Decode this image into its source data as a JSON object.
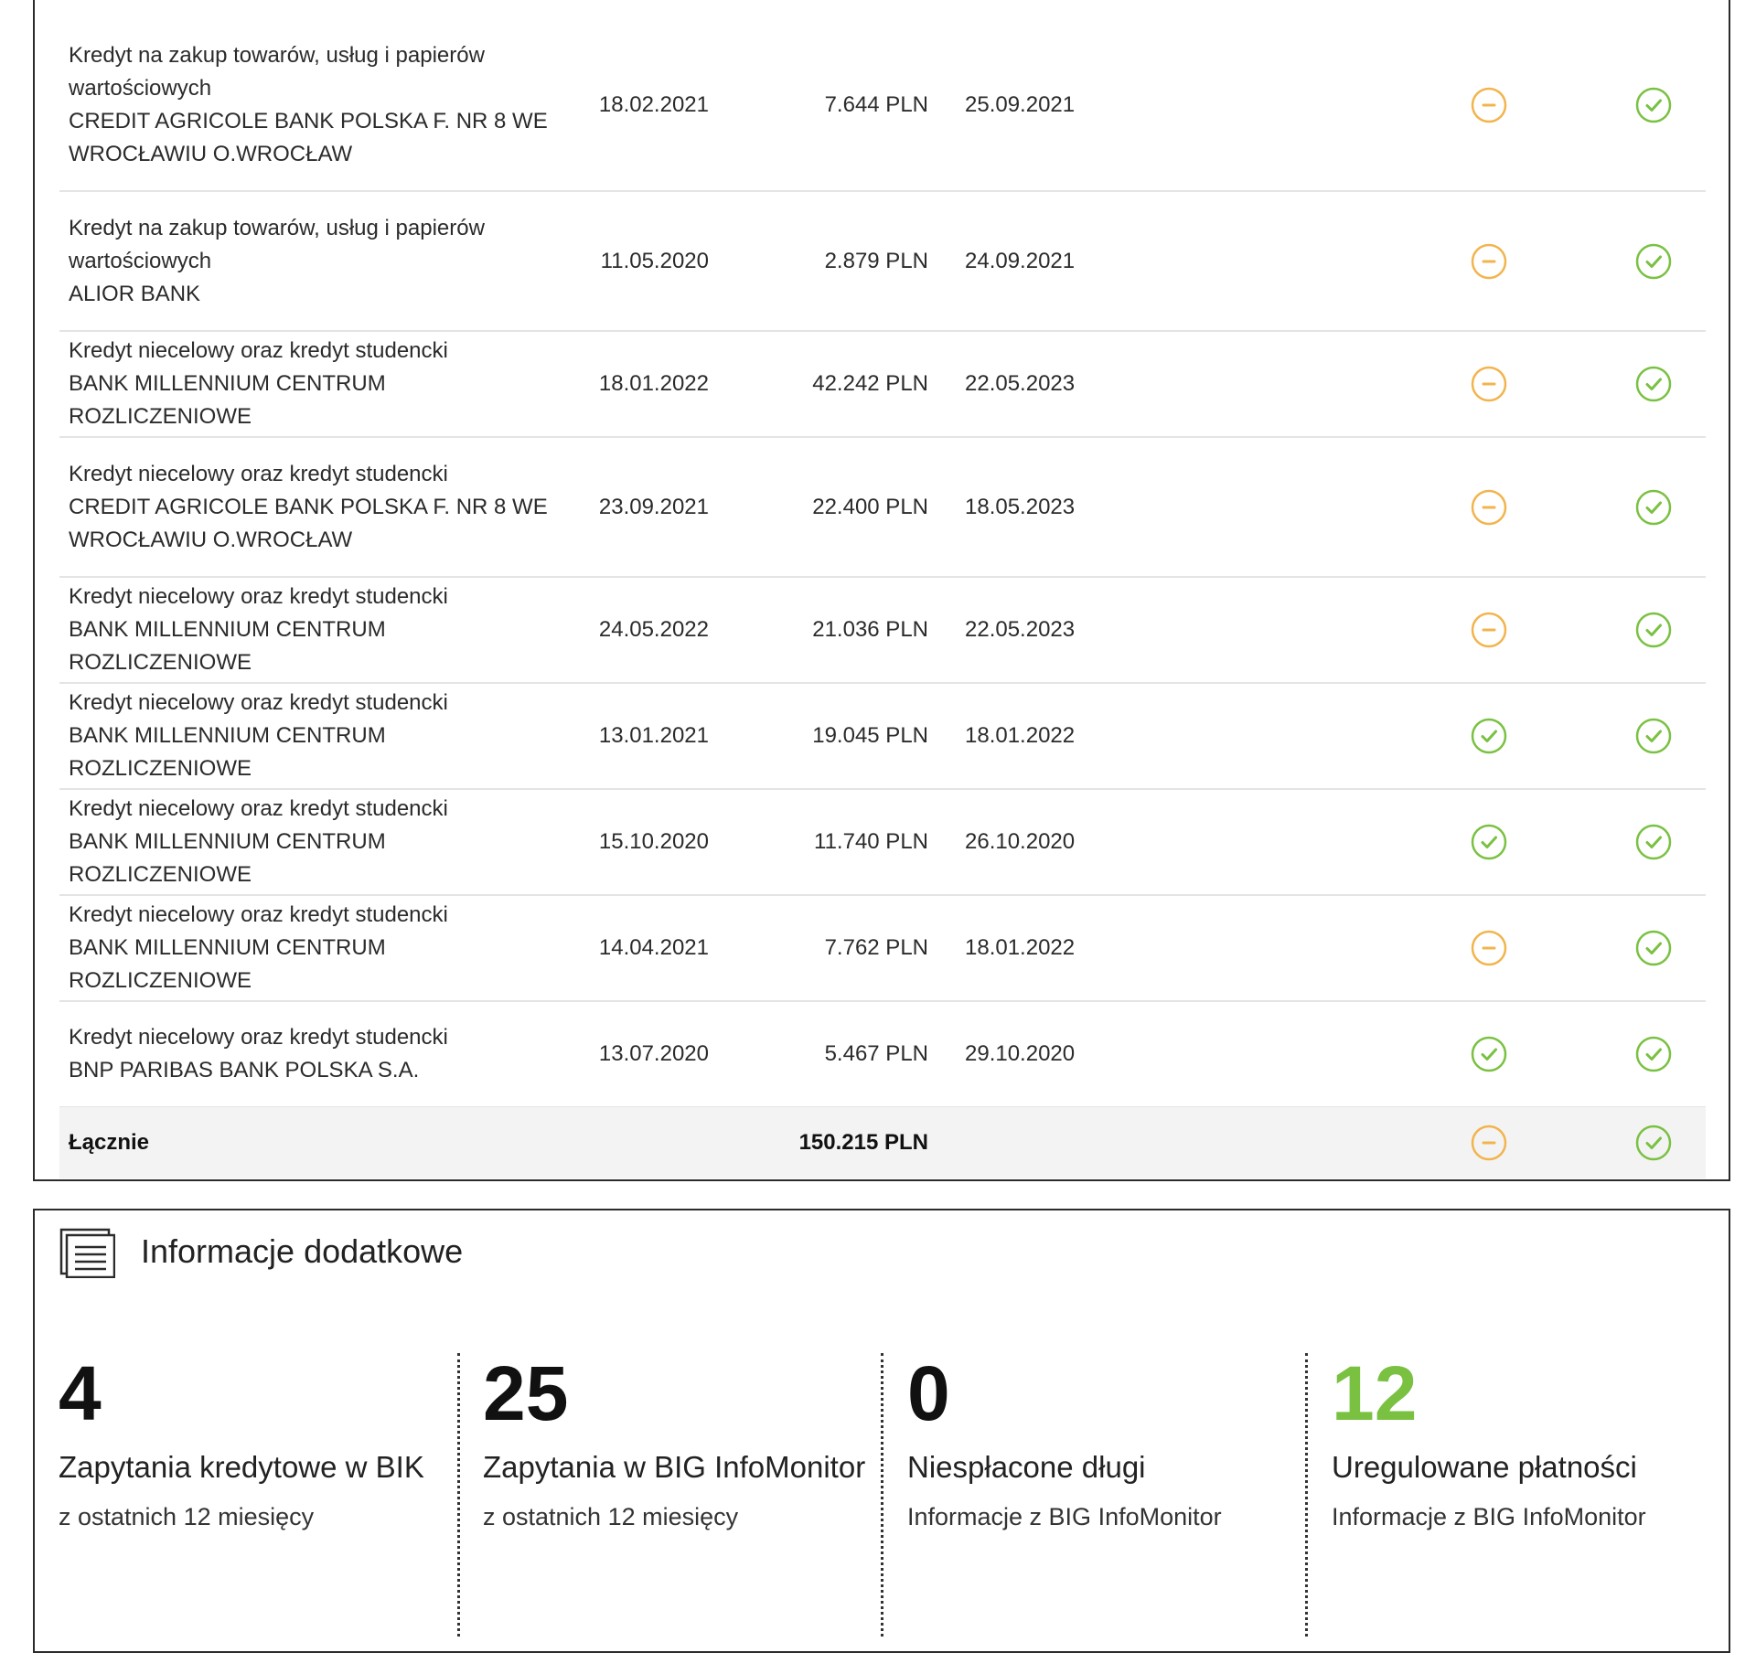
{
  "colors": {
    "pending": "#f2b44c",
    "ok": "#7ac142",
    "highlight": "#7ac142"
  },
  "icons": {
    "pending": "minus-circle-icon",
    "ok": "check-circle-icon",
    "info": "document-lines-icon"
  },
  "credits": [
    {
      "lines": [
        "Kredyt na zakup towarów, usług i papierów",
        "wartościowych",
        "CREDIT AGRICOLE BANK POLSKA F. NR 8 WE",
        "WROCŁAWIU O.WROCŁAW"
      ],
      "date": "18.02.2021",
      "amount": "7.644 PLN",
      "end_date": "25.09.2021",
      "status1": "pending",
      "status2": "ok"
    },
    {
      "lines": [
        "Kredyt na zakup towarów, usług i papierów",
        "wartościowych",
        "ALIOR BANK"
      ],
      "date": "11.05.2020",
      "amount": "2.879 PLN",
      "end_date": "24.09.2021",
      "status1": "pending",
      "status2": "ok"
    },
    {
      "lines": [
        "Kredyt niecelowy oraz kredyt studencki",
        "BANK MILLENNIUM CENTRUM ROZLICZENIOWE"
      ],
      "date": "18.01.2022",
      "amount": "42.242 PLN",
      "end_date": "22.05.2023",
      "status1": "pending",
      "status2": "ok"
    },
    {
      "lines": [
        "Kredyt niecelowy oraz kredyt studencki",
        "CREDIT AGRICOLE BANK POLSKA F. NR 8 WE",
        "WROCŁAWIU O.WROCŁAW"
      ],
      "date": "23.09.2021",
      "amount": "22.400 PLN",
      "end_date": "18.05.2023",
      "status1": "pending",
      "status2": "ok"
    },
    {
      "lines": [
        "Kredyt niecelowy oraz kredyt studencki",
        "BANK MILLENNIUM CENTRUM ROZLICZENIOWE"
      ],
      "date": "24.05.2022",
      "amount": "21.036 PLN",
      "end_date": "22.05.2023",
      "status1": "pending",
      "status2": "ok"
    },
    {
      "lines": [
        "Kredyt niecelowy oraz kredyt studencki",
        "BANK MILLENNIUM CENTRUM ROZLICZENIOWE"
      ],
      "date": "13.01.2021",
      "amount": "19.045 PLN",
      "end_date": "18.01.2022",
      "status1": "ok",
      "status2": "ok"
    },
    {
      "lines": [
        "Kredyt niecelowy oraz kredyt studencki",
        "BANK MILLENNIUM CENTRUM ROZLICZENIOWE"
      ],
      "date": "15.10.2020",
      "amount": "11.740 PLN",
      "end_date": "26.10.2020",
      "status1": "ok",
      "status2": "ok"
    },
    {
      "lines": [
        "Kredyt niecelowy oraz kredyt studencki",
        "BANK MILLENNIUM CENTRUM ROZLICZENIOWE"
      ],
      "date": "14.04.2021",
      "amount": "7.762 PLN",
      "end_date": "18.01.2022",
      "status1": "pending",
      "status2": "ok"
    },
    {
      "lines": [
        "Kredyt niecelowy oraz kredyt studencki",
        "BNP PARIBAS BANK POLSKA S.A."
      ],
      "date": "13.07.2020",
      "amount": "5.467 PLN",
      "end_date": "29.10.2020",
      "status1": "ok",
      "status2": "ok"
    }
  ],
  "total": {
    "label": "Łącznie",
    "amount": "150.215 PLN",
    "status1": "pending",
    "status2": "ok"
  },
  "info": {
    "title": "Informacje dodatkowe",
    "stats": [
      {
        "value": "4",
        "label": "Zapytania kredytowe w BIK",
        "sub": "z ostatnich 12 miesięcy",
        "highlight": false
      },
      {
        "value": "25",
        "label": "Zapytania w BIG InfoMonitor",
        "sub": "z ostatnich 12 miesięcy",
        "highlight": false
      },
      {
        "value": "0",
        "label": "Niespłacone długi",
        "sub": "Informacje z BIG InfoMonitor",
        "highlight": false
      },
      {
        "value": "12",
        "label": "Uregulowane płatności",
        "sub": "Informacje z BIG InfoMonitor",
        "highlight": true
      }
    ]
  }
}
